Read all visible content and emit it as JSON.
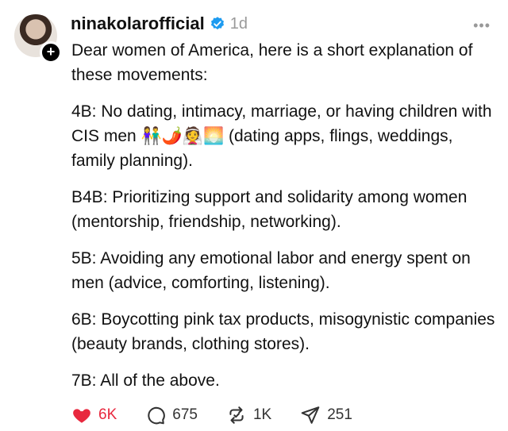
{
  "post": {
    "username": "ninakolarofficial",
    "time": "1d",
    "more_label": "•••",
    "follow_badge": "+",
    "paragraphs": [
      "Dear women of America, here is a short explanation of these movements:",
      "4B: No dating, intimacy, marriage, or having children with CIS men 👫🌶️👰🌅 (dating apps, flings, weddings, family planning).",
      "B4B: Prioritizing support and solidarity among women (mentorship, friendship, networking).",
      "5B: Avoiding any emotional labor and energy spent on men (advice, comforting, listening).",
      "6B: Boycotting pink tax products, misogynistic companies (beauty brands, clothing stores).",
      "7B: All of the above."
    ]
  },
  "actions": {
    "likes": "6K",
    "replies": "675",
    "reposts": "1K",
    "shares": "251"
  },
  "colors": {
    "like": "#e8283e",
    "verified": "#1d9bf0"
  },
  "icons": {
    "like": "heart-icon",
    "reply": "comment-icon",
    "repost": "repost-icon",
    "share": "send-icon",
    "verified": "verified-badge-icon",
    "more": "more-icon"
  }
}
